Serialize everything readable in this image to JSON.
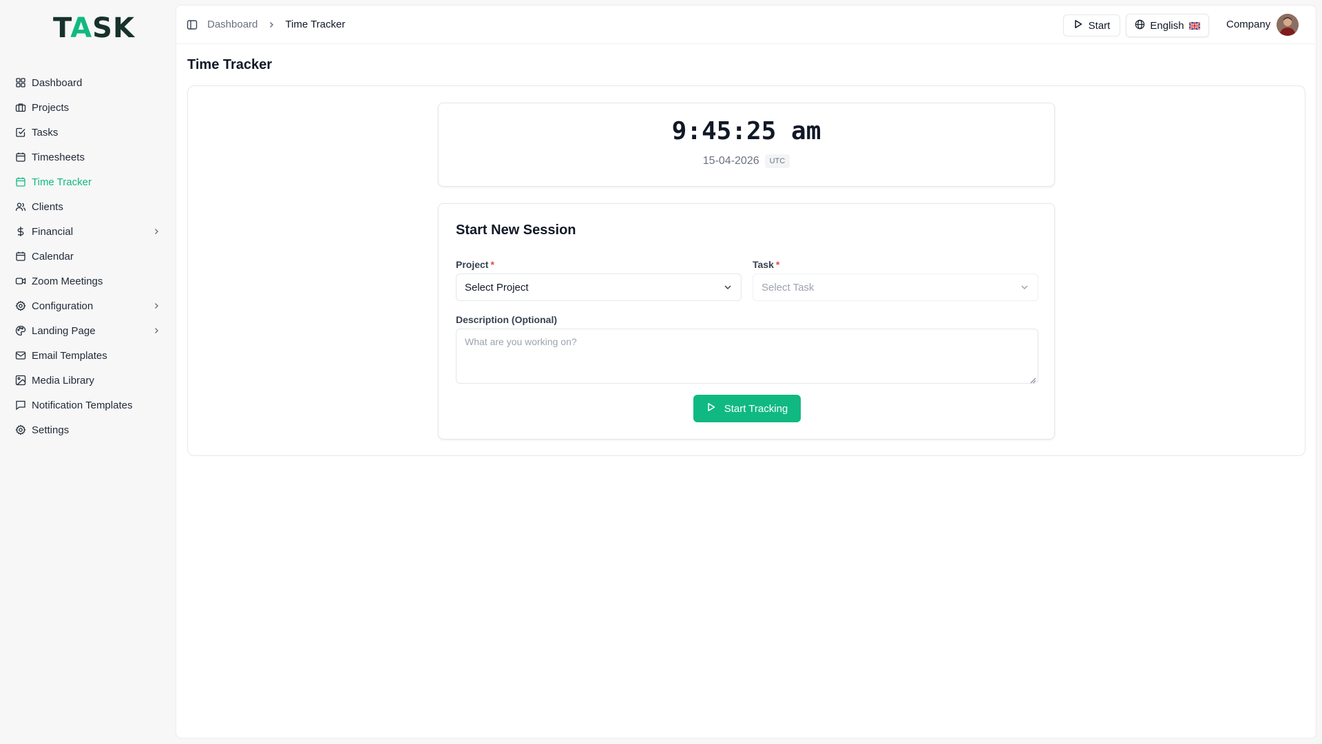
{
  "brand": {
    "logo_t": "T",
    "logo_a": "A",
    "logo_sk": "SK",
    "accent": "#10b981"
  },
  "sidebar": {
    "items": [
      {
        "label": "Dashboard",
        "icon": "grid-icon"
      },
      {
        "label": "Projects",
        "icon": "briefcase-icon"
      },
      {
        "label": "Tasks",
        "icon": "checkbox-icon"
      },
      {
        "label": "Timesheets",
        "icon": "calendar-icon"
      },
      {
        "label": "Time Tracker",
        "icon": "calendar-clock-icon",
        "active": true
      },
      {
        "label": "Clients",
        "icon": "users-icon"
      },
      {
        "label": "Financial",
        "icon": "dollar-icon",
        "has_children": true
      },
      {
        "label": "Calendar",
        "icon": "calendar-icon"
      },
      {
        "label": "Zoom Meetings",
        "icon": "video-icon"
      },
      {
        "label": "Configuration",
        "icon": "gear-icon",
        "has_children": true
      },
      {
        "label": "Landing Page",
        "icon": "palette-icon",
        "has_children": true
      },
      {
        "label": "Email Templates",
        "icon": "mail-icon"
      },
      {
        "label": "Media Library",
        "icon": "image-icon"
      },
      {
        "label": "Notification Templates",
        "icon": "message-icon"
      },
      {
        "label": "Settings",
        "icon": "gear-icon"
      }
    ]
  },
  "header": {
    "breadcrumb": [
      "Dashboard",
      "Time Tracker"
    ],
    "start_label": "Start",
    "language_label": "English",
    "company_label": "Company"
  },
  "main": {
    "page_title": "Time Tracker",
    "clock": {
      "time": "9:45:25 am",
      "date": "15-04-2026",
      "timezone": "UTC"
    },
    "session": {
      "title": "Start New Session",
      "project_label": "Project",
      "project_value": "Select Project",
      "task_label": "Task",
      "task_placeholder": "Select Task",
      "required_mark": "*",
      "description_label": "Description (Optional)",
      "description_placeholder": "What are you working on?",
      "submit_label": "Start Tracking"
    }
  }
}
